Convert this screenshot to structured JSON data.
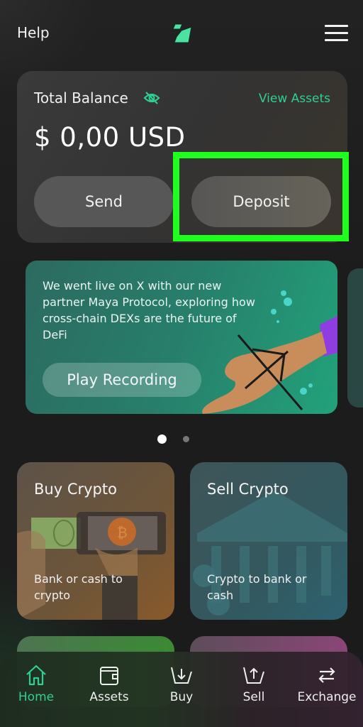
{
  "header": {
    "help_label": "Help",
    "logo": "app-logo",
    "menu_icon": "hamburger-menu-icon"
  },
  "balance": {
    "label": "Total Balance",
    "visibility_icon": "eye-slash-icon",
    "view_assets_label": "View Assets",
    "amount": "$ 0,00 USD",
    "send_label": "Send",
    "deposit_label": "Deposit"
  },
  "promo": {
    "text": "We went live on X with our new partner Maya Protocol, exploring how cross-chain DEXs are the future of DeFi",
    "button_label": "Play Recording",
    "pages": 2,
    "active_page": 1
  },
  "tiles": [
    {
      "title": "Buy Crypto",
      "subtitle": "Bank or cash to crypto"
    },
    {
      "title": "Sell Crypto",
      "subtitle": "Crypto to bank or cash"
    }
  ],
  "nav": {
    "items": [
      {
        "label": "Home",
        "icon": "home-icon",
        "active": true
      },
      {
        "label": "Assets",
        "icon": "wallet-icon",
        "active": false
      },
      {
        "label": "Buy",
        "icon": "basket-down-icon",
        "active": false
      },
      {
        "label": "Sell",
        "icon": "basket-up-icon",
        "active": false
      },
      {
        "label": "Exchange",
        "icon": "exchange-arrows-icon",
        "active": false
      }
    ]
  },
  "colors": {
    "accent": "#2fcf93",
    "highlight": "#1eff1e",
    "background": "#1b1b1b"
  }
}
